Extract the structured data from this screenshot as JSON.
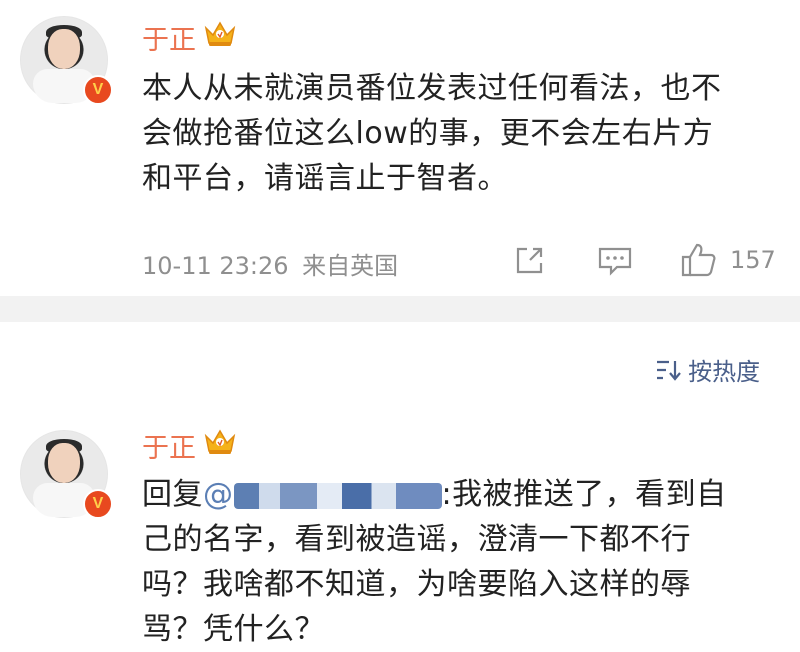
{
  "post": {
    "author": "于正",
    "crown_icon": "crown-icon",
    "verified_badge": "V",
    "text": [
      "本人从未就演员番位发表过任何看法，也不",
      "会做抢番位这么low的事，更不会左右片方",
      "和平台，请谣言止于智者。"
    ],
    "timestamp": "10-11 23:26",
    "source": "来自英国",
    "like_count": "157"
  },
  "comments_header": {
    "sort_icon": "sort-icon",
    "sort_label": "按热度"
  },
  "reply": {
    "author": "于正",
    "verified_badge": "V",
    "prefix": "回复",
    "mention_at": "@",
    "text_after_mention": ":我被推送了，看到自",
    "lines": [
      "己的名字，看到被造谣，澄清一下都不行",
      "吗？我啥都不知道，为啥要陷入这样的辱",
      "骂？凭什么？"
    ]
  }
}
